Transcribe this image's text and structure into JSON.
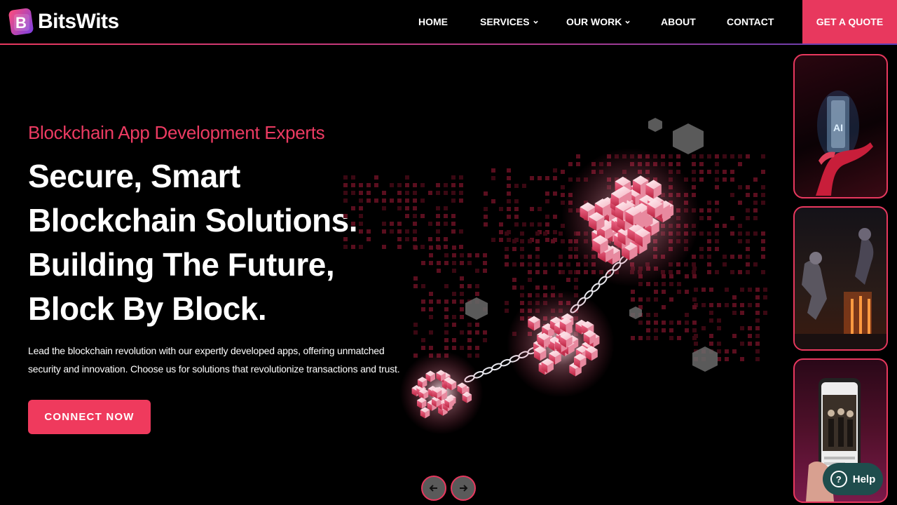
{
  "brand": {
    "name": "BitsWits",
    "mark_letter": "B",
    "colors": {
      "accent": "#e8385e",
      "violet": "#7b3fe4"
    }
  },
  "nav": {
    "items": [
      {
        "label": "HOME",
        "dropdown": false
      },
      {
        "label": "SERVICES",
        "dropdown": true
      },
      {
        "label": "OUR WORK",
        "dropdown": true
      },
      {
        "label": "ABOUT",
        "dropdown": false
      },
      {
        "label": "CONTACT",
        "dropdown": false
      }
    ],
    "quote_label": "GET A QUOTE"
  },
  "hero": {
    "eyebrow": "Blockchain App Development Experts",
    "headline": [
      "Secure, Smart",
      "Blockchain Solutions.",
      "Building The Future,",
      "Block By Block."
    ],
    "description": "Lead the blockchain revolution with our expertly developed apps, offering unmatched security and innovation. Choose us for solutions that revolutionize transactions and trust.",
    "cta_label": "CONNECT NOW"
  },
  "carousel": {
    "prev_icon": "arrow-left-icon",
    "next_icon": "arrow-right-icon"
  },
  "side_cards": [
    {
      "name": "ai-hand-card",
      "text": "AI"
    },
    {
      "name": "game-battle-card"
    },
    {
      "name": "mobile-app-card"
    }
  ],
  "help": {
    "label": "Help",
    "icon": "question-icon"
  }
}
